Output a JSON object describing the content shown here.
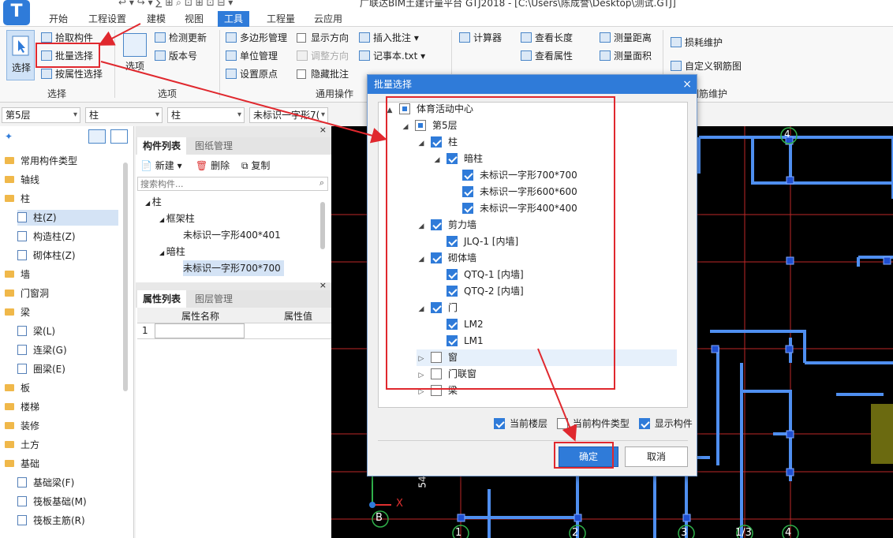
{
  "app": {
    "logo_letter": "T",
    "title": "广联达BIM土建计量平台 GTJ2018 - [C:\\Users\\陈成誉\\Desktop\\测试.GTJ]",
    "quick_access": "↩ ▾ ↪ ▾ ∑ ⊞ ⌕ ⊡ ⊞ ⊡ ⊟ ▾"
  },
  "menu": {
    "tabs": [
      "开始",
      "工程设置",
      "建模",
      "视图",
      "工具",
      "工程量",
      "云应用"
    ],
    "active_index": 4
  },
  "ribbon": {
    "select_big": "选择",
    "pick_component": "拾取构件",
    "batch_select": "批量选择",
    "select_by_attr": "按属性选择",
    "group_select": "选择",
    "options_btn": "选项",
    "check_update": "检测更新",
    "version": "版本号",
    "group_options": "选项",
    "polygon_mgmt": "多边形管理",
    "unit_mgmt": "单位管理",
    "set_origin": "设置原点",
    "show_direction": "显示方向",
    "adjust_direction": "调整方向",
    "hide_annotation": "隐藏批注",
    "insert_annotation": "插入批注",
    "notepad": "记事本.txt",
    "group_common": "通用操作",
    "calculator": "计算器",
    "view_length": "查看长度",
    "view_attr": "查看属性",
    "measure_distance": "测量距离",
    "measure_area": "测量面积",
    "loss_maintenance": "损耗维护",
    "custom_rebar": "自定义钢筋图",
    "group_rebar": "钢筋维护"
  },
  "dropdowns": [
    "第5层",
    "柱",
    "柱",
    "未标识一字形7("
  ],
  "left_tree": {
    "items": [
      {
        "type": "folder",
        "label": "常用构件类型"
      },
      {
        "type": "folder",
        "label": "轴线"
      },
      {
        "type": "folder",
        "label": "柱"
      },
      {
        "type": "sub",
        "label": "柱(Z)",
        "selected": true
      },
      {
        "type": "sub",
        "label": "构造柱(Z)"
      },
      {
        "type": "sub",
        "label": "砌体柱(Z)"
      },
      {
        "type": "folder",
        "label": "墙"
      },
      {
        "type": "folder",
        "label": "门窗洞"
      },
      {
        "type": "folder",
        "label": "梁"
      },
      {
        "type": "sub",
        "label": "梁(L)"
      },
      {
        "type": "sub",
        "label": "连梁(G)"
      },
      {
        "type": "sub",
        "label": "圈梁(E)"
      },
      {
        "type": "folder",
        "label": "板"
      },
      {
        "type": "folder",
        "label": "楼梯"
      },
      {
        "type": "folder",
        "label": "装修"
      },
      {
        "type": "folder",
        "label": "土方"
      },
      {
        "type": "folder",
        "label": "基础"
      },
      {
        "type": "sub",
        "label": "基础梁(F)"
      },
      {
        "type": "sub",
        "label": "筏板基础(M)"
      },
      {
        "type": "sub",
        "label": "筏板主筋(R)"
      }
    ]
  },
  "component_list": {
    "tab_active": "构件列表",
    "tab_inactive": "图纸管理",
    "new_btn": "新建",
    "delete_btn": "删除",
    "copy_btn": "复制",
    "search_placeholder": "搜索构件...",
    "tree": [
      {
        "level": 0,
        "label": "柱"
      },
      {
        "level": 1,
        "label": "框架柱"
      },
      {
        "level": 2,
        "label": "未标识一字形400*401"
      },
      {
        "level": 1,
        "label": "暗柱"
      },
      {
        "level": 2,
        "label": "未标识一字形700*700",
        "selected": true
      }
    ]
  },
  "property_list": {
    "tab_active": "属性列表",
    "tab_inactive": "图层管理",
    "col_name": "属性名称",
    "col_value": "属性值",
    "row1": "1"
  },
  "canvas": {
    "axis_bottom": [
      "1",
      "2",
      "3",
      "1/3",
      "4"
    ],
    "axis_left": "B",
    "axis_top": "4",
    "x_label": "X",
    "y_num": "54"
  },
  "dialog": {
    "title": "批量选择",
    "close": "×",
    "tree": [
      {
        "level": 0,
        "label": "体育活动中心",
        "check": "part",
        "tw": "▲"
      },
      {
        "level": 1,
        "label": "第5层",
        "check": "part",
        "tw": "◢"
      },
      {
        "level": 2,
        "label": "柱",
        "check": "on",
        "tw": "◢"
      },
      {
        "level": 3,
        "label": "暗柱",
        "check": "on",
        "tw": "◢"
      },
      {
        "level": 4,
        "label": "未标识一字形700*700",
        "check": "on",
        "tw": ""
      },
      {
        "level": 4,
        "label": "未标识一字形600*600",
        "check": "on",
        "tw": ""
      },
      {
        "level": 4,
        "label": "未标识一字形400*400",
        "check": "on",
        "tw": ""
      },
      {
        "level": 2,
        "label": "剪力墙",
        "check": "on",
        "tw": "◢"
      },
      {
        "level": 3,
        "label": "JLQ-1 [内墙]",
        "check": "on",
        "tw": ""
      },
      {
        "level": 2,
        "label": "砌体墙",
        "check": "on",
        "tw": "◢"
      },
      {
        "level": 3,
        "label": "QTQ-1 [内墙]",
        "check": "on",
        "tw": ""
      },
      {
        "level": 3,
        "label": "QTQ-2 [内墙]",
        "check": "on",
        "tw": ""
      },
      {
        "level": 2,
        "label": "门",
        "check": "on",
        "tw": "◢"
      },
      {
        "level": 3,
        "label": "LM2",
        "check": "on",
        "tw": ""
      },
      {
        "level": 3,
        "label": "LM1",
        "check": "on",
        "tw": ""
      },
      {
        "level": 2,
        "label": "窗",
        "check": "off",
        "tw": "▷",
        "highlight": true
      },
      {
        "level": 2,
        "label": "门联窗",
        "check": "off",
        "tw": "▷"
      },
      {
        "level": 2,
        "label": "梁",
        "check": "off",
        "tw": "▷"
      }
    ],
    "opt_current_floor": "当前楼层",
    "opt_current_type": "当前构件类型",
    "opt_show_components": "显示构件",
    "ok": "确定",
    "cancel": "取消"
  },
  "colors": {
    "accent": "#2f7bd9",
    "red_annotation": "#e0282e",
    "canvas_bg": "#000000",
    "wall_blue": "#4f8ff0"
  }
}
